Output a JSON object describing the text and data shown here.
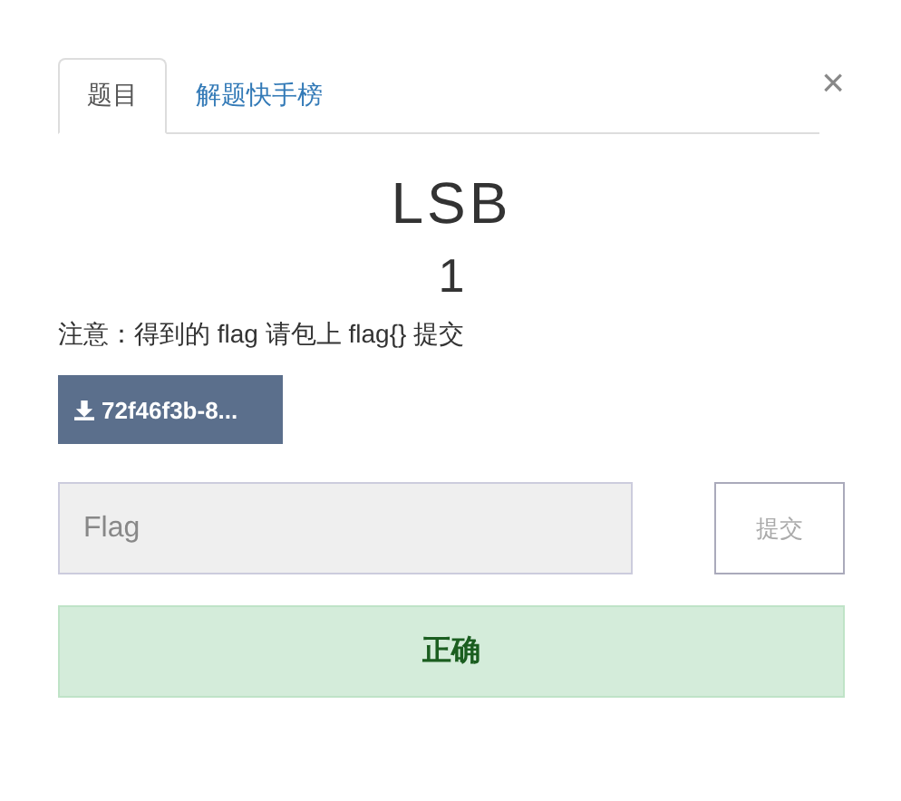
{
  "tabs": [
    {
      "label": "题目",
      "selected": true
    },
    {
      "label": "解题快手榜",
      "selected": false
    }
  ],
  "close": "×",
  "title": "LSB",
  "points": "1",
  "note": "注意：得到的 flag 请包上 flag{} 提交",
  "download": {
    "label": "72f46f3b-8..."
  },
  "flag_field": {
    "placeholder": "Flag"
  },
  "submit": "提交",
  "result": {
    "text": "正确",
    "kind": "success"
  }
}
